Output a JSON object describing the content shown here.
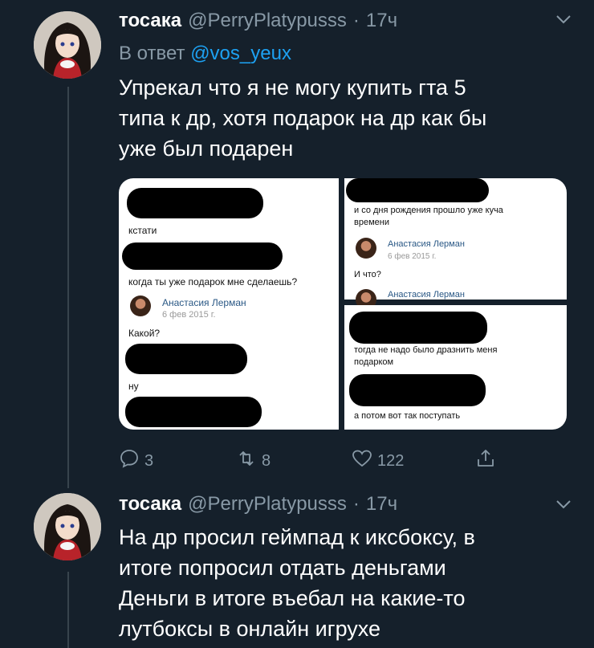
{
  "tweets": [
    {
      "name": "тосака",
      "handle": "@PerryPlatypusss",
      "separator": "·",
      "time": "17ч",
      "reply_prefix": "В ответ",
      "reply_to": "@vos_yeux",
      "text_lines": [
        "Упрекал что я не могу купить гта 5",
        "типа к др, хотя подарок на др как бы",
        "уже был подарен"
      ],
      "actions": {
        "replies": "3",
        "retweets": "8",
        "likes": "122"
      }
    },
    {
      "name": "тосака",
      "handle": "@PerryPlatypusss",
      "separator": "·",
      "time": "17ч",
      "text_lines": [
        "На др просил геймпад к иксбоксу, в",
        "итоге попросил отдать деньгами",
        "Деньги в итоге въебал на какие-то",
        "лутбоксы в онлайн игрухе"
      ]
    }
  ],
  "screenshot": {
    "left": {
      "msg1": "кстати",
      "msg2": "когда ты уже подарок мне сделаешь?",
      "sender": "Анастасия Лерман",
      "date": "6 фев 2015 г.",
      "msg3": "Какой?",
      "msg4": "ну"
    },
    "top_right": {
      "msg1_line1": "и со дня рождения прошло уже куча",
      "msg1_line2": "времени",
      "sender": "Анастасия Лерман",
      "date": "6 фев 2015 г.",
      "msg2": "И что?",
      "sender2": "Анастасия Лерман"
    },
    "bottom_right": {
      "msg1_line1": "тогда не надо было дразнить меня",
      "msg1_line2": "подарком",
      "msg2": "а потом вот так поступать"
    }
  },
  "icons": {
    "reply": "comment-icon",
    "retweet": "retweet-icon",
    "like": "heart-icon",
    "share": "share-icon",
    "menu": "chevron-down-icon"
  },
  "colors": {
    "background": "#15202b",
    "secondary_text": "#8899a6",
    "link": "#1da1f2",
    "thread_line": "#38444d"
  }
}
